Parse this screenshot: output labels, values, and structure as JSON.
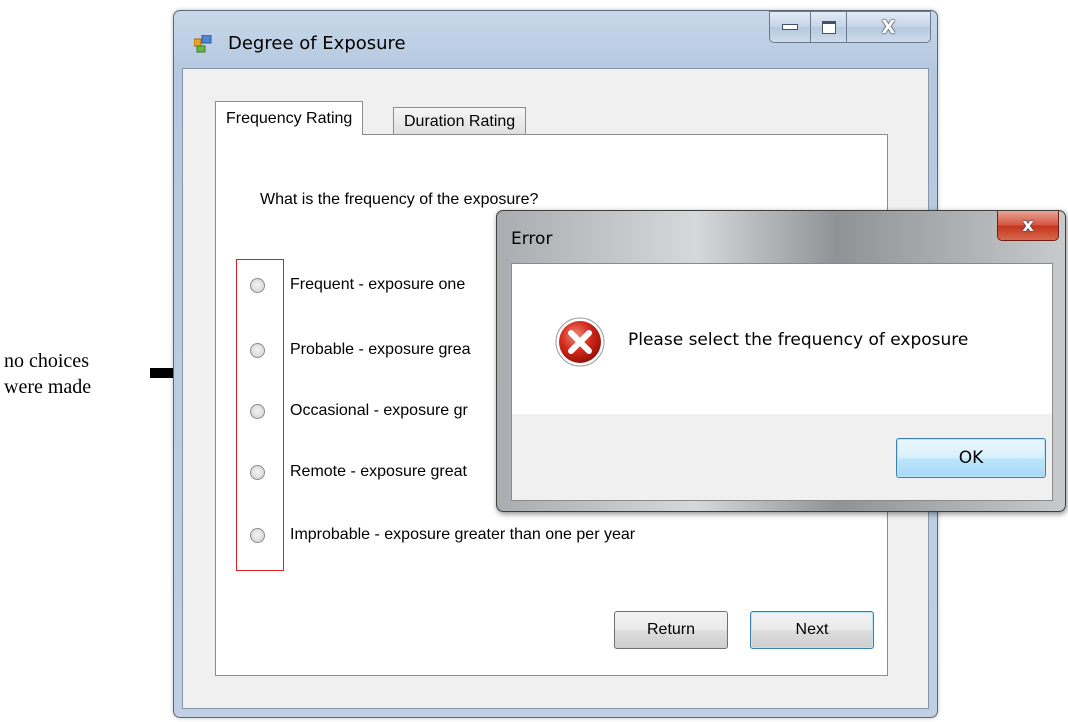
{
  "annotation": {
    "text_line1": "no choices",
    "text_line2": "were made"
  },
  "main_window": {
    "title": "Degree of Exposure",
    "tabs": [
      {
        "label": "Frequency Rating",
        "selected": true
      },
      {
        "label": "Duration Rating",
        "selected": false
      }
    ],
    "question": "What is the frequency of the exposure?",
    "options": [
      {
        "label": "Frequent - exposure one",
        "checked": false
      },
      {
        "label": "Probable - exposure grea",
        "checked": false
      },
      {
        "label": "Occasional - exposure gr",
        "checked": false
      },
      {
        "label": "Remote - exposure great",
        "checked": false
      },
      {
        "label": "Improbable - exposure greater than one per year",
        "checked": false
      }
    ],
    "buttons": {
      "return_label": "Return",
      "next_label": "Next"
    },
    "caption": {
      "close_glyph": "X"
    }
  },
  "error_dialog": {
    "title": "Error",
    "message": "Please select the frequency of exposure",
    "ok_label": "OK",
    "icon": "error-icon",
    "close_glyph": "x"
  },
  "colors": {
    "highlight_box": "#e02020",
    "error_red": "#c3331b",
    "accent_blue": "#3c7fb1"
  }
}
